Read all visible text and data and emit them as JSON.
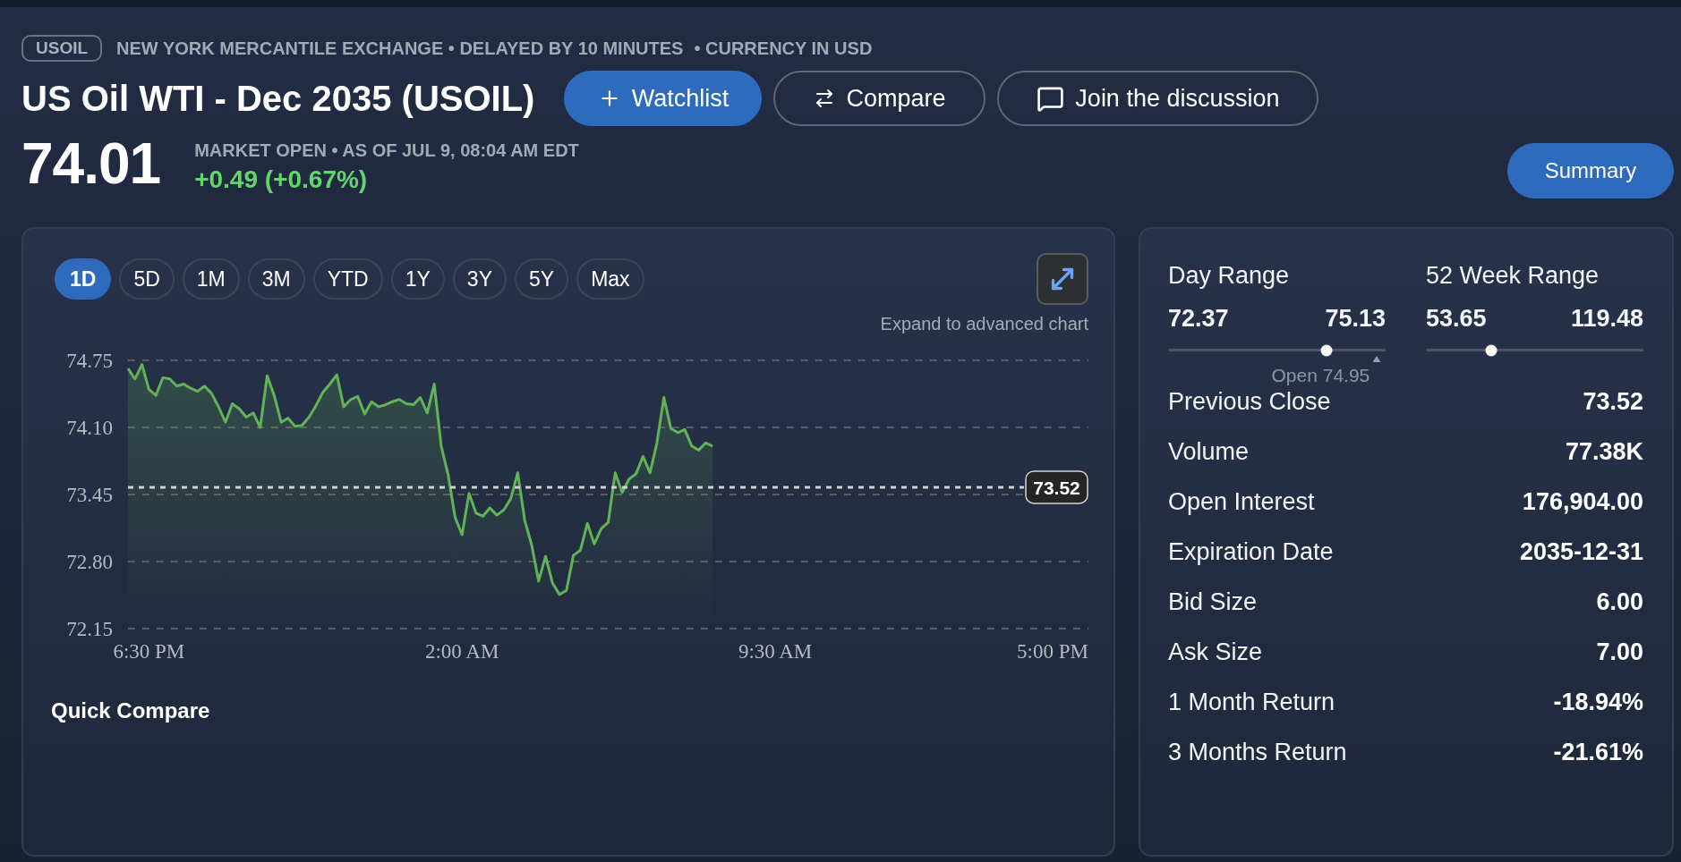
{
  "header": {
    "symbol_badge": "USOIL",
    "exchange_info": "NEW YORK MERCANTILE EXCHANGE • DELAYED BY 10 MINUTES",
    "currency_info": "• CURRENCY IN USD",
    "title": "US Oil WTI - Dec 2035 (USOIL)",
    "actions": [
      {
        "kind": "primary",
        "label": "Watchlist"
      },
      {
        "kind": "outline",
        "label": "Compare"
      },
      {
        "kind": "outline",
        "label": "Join the discussion"
      }
    ],
    "price": "74.01",
    "market_status": "MARKET OPEN • AS OF JUL 9, 08:04 AM EDT",
    "change": "+0.49 (+0.67%)",
    "summary_button": "Summary"
  },
  "chart_panel": {
    "ranges": [
      {
        "label": "1D",
        "selected": true
      },
      {
        "label": "5D",
        "selected": false
      },
      {
        "label": "1M",
        "selected": false
      },
      {
        "label": "3M",
        "selected": false
      },
      {
        "label": "YTD",
        "selected": false
      },
      {
        "label": "1Y",
        "selected": false
      },
      {
        "label": "3Y",
        "selected": false
      },
      {
        "label": "5Y",
        "selected": false
      },
      {
        "label": "Max",
        "selected": false
      }
    ],
    "expand_caption": "Expand to advanced chart",
    "chart_data": {
      "type": "area",
      "categories": [
        null,
        null,
        null,
        "6:30 PM",
        null,
        null,
        null,
        null,
        null,
        null,
        null,
        null,
        null,
        null,
        null,
        null,
        null,
        null,
        null,
        null,
        null,
        null,
        null,
        null,
        null,
        null,
        null,
        null,
        null,
        null,
        null,
        null,
        null,
        null,
        null,
        null,
        null,
        null,
        null,
        null,
        null,
        null,
        null,
        null,
        null,
        null,
        null,
        null,
        "2:00 AM",
        null,
        null,
        null,
        null,
        null,
        null,
        null,
        null,
        null,
        null,
        null,
        null,
        null,
        null,
        null,
        null,
        null,
        null,
        null,
        null,
        null,
        null,
        null,
        null,
        null,
        null,
        null,
        null,
        null,
        null,
        null,
        null,
        null,
        null,
        null,
        null,
        null,
        null,
        null,
        null,
        null,
        null,
        null,
        null,
        "9:30 AM",
        null,
        null,
        null,
        null,
        null,
        null,
        null,
        null,
        null,
        null,
        null,
        null,
        null,
        null,
        null,
        null,
        null,
        null,
        null,
        null,
        null,
        null,
        null,
        null,
        null,
        null,
        null,
        null,
        null,
        null,
        null,
        null,
        null,
        null,
        null,
        null,
        null,
        null,
        null,
        null,
        null,
        null,
        null,
        null,
        "5:00 PM"
      ],
      "series": [
        {
          "color": "#62b357",
          "values": [
            74.67,
            74.57,
            74.71,
            74.47,
            74.41,
            74.58,
            74.57,
            74.5,
            74.52,
            74.48,
            74.45,
            74.5,
            74.43,
            74.3,
            74.15,
            74.33,
            74.28,
            74.2,
            74.24,
            74.1,
            74.6,
            74.41,
            74.15,
            74.19,
            74.11,
            74.12,
            74.2,
            74.31,
            74.44,
            74.52,
            74.61,
            74.3,
            74.37,
            74.4,
            74.23,
            74.35,
            74.3,
            74.32,
            74.35,
            74.37,
            74.33,
            74.32,
            74.39,
            74.24,
            74.52,
            73.92,
            73.64,
            73.23,
            73.06,
            73.46,
            73.27,
            73.24,
            73.32,
            73.25,
            73.3,
            73.41,
            73.66,
            73.2,
            72.96,
            72.61,
            72.85,
            72.59,
            72.48,
            72.52,
            72.86,
            72.91,
            73.17,
            72.97,
            73.12,
            73.18,
            73.66,
            73.47,
            73.6,
            73.65,
            73.82,
            73.66,
            73.95,
            74.39,
            74.09,
            74.05,
            74.08,
            73.92,
            73.88,
            73.95,
            73.92,
            null,
            null,
            null,
            null,
            null,
            null,
            null,
            null,
            null,
            null,
            null,
            null,
            null,
            null,
            null,
            null,
            null,
            null,
            null,
            null,
            null,
            null,
            null,
            null,
            null,
            null,
            null,
            null,
            null,
            null,
            null,
            null,
            null,
            null,
            null,
            null,
            null,
            null,
            null,
            null,
            null,
            null,
            null,
            null,
            null,
            null,
            null,
            null,
            null,
            null,
            null,
            null,
            null,
            null
          ]
        }
      ],
      "ylim": [
        72.15,
        74.75
      ],
      "yticks": [
        {
          "value": 74.75,
          "label": "74.75"
        },
        {
          "value": 74.1,
          "label": "74.10"
        },
        {
          "value": 73.45,
          "label": "73.45"
        },
        {
          "value": 72.8,
          "label": "72.80"
        },
        {
          "value": 72.15,
          "label": "72.15"
        }
      ],
      "grid": true,
      "ref_lines": [
        {
          "axis": "y",
          "value": 73.52,
          "label": "73.52"
        }
      ]
    },
    "quick_compare_title": "Quick Compare"
  },
  "stats_panel": {
    "ranges": [
      {
        "title": "Day Range",
        "low": "72.37",
        "high": "75.13",
        "level": 0.73,
        "marker": {
          "label": "Open 74.95",
          "level": 0.96
        }
      },
      {
        "title": "52 Week Range",
        "low": "53.65",
        "high": "119.48",
        "level": 0.3
      }
    ],
    "rows": [
      {
        "label": "Previous Close",
        "value": "73.52"
      },
      {
        "label": "Volume",
        "value": "77.38K"
      },
      {
        "label": "Open Interest",
        "value": "176,904.00"
      },
      {
        "label": "Expiration Date",
        "value": "2035-12-31"
      },
      {
        "label": "Bid Size",
        "value": "6.00"
      },
      {
        "label": "Ask Size",
        "value": "7.00"
      },
      {
        "label": "1 Month Return",
        "value": "-18.94%"
      },
      {
        "label": "3 Months Return",
        "value": "-21.61%"
      }
    ]
  }
}
